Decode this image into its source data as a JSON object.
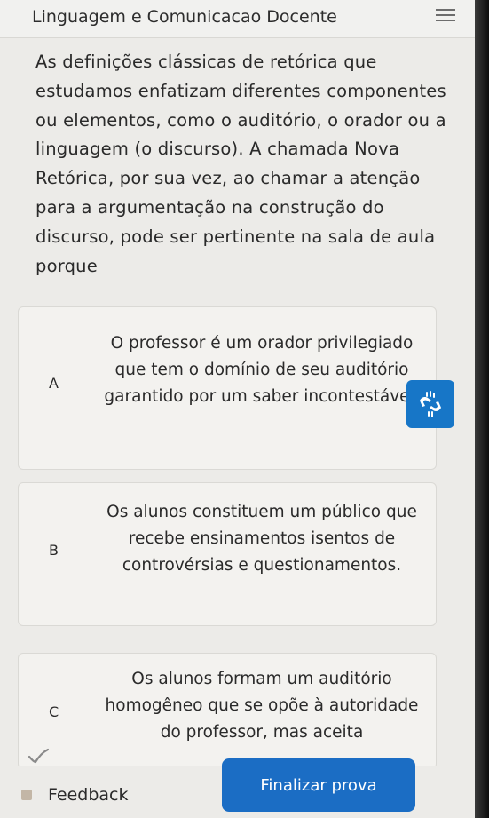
{
  "header": {
    "title": "Linguagem e Comunicacao Docente",
    "menu_icon": "hamburger-menu-icon"
  },
  "question": {
    "text": "As definições clássicas de retórica que estudamos enfatizam diferentes componentes ou elementos, como o auditório, o orador ou a linguagem (o discurso). A chamada Nova Retórica, por sua vez, ao chamar a atenção para a argumentação na construção do discurso, pode ser pertinente na sala de aula porque"
  },
  "options": [
    {
      "letter": "A",
      "text": "O professor é um orador privilegiado que tem o domínio de seu auditório garantido por um saber incontestável."
    },
    {
      "letter": "B",
      "text": "Os alunos constituem um público que recebe ensinamentos isentos de controvérsias e questionamentos."
    },
    {
      "letter": "C",
      "text": "Os alunos formam um auditório homogêneo que se opõe à autoridade do professor, mas aceita"
    }
  ],
  "accessibility_button": {
    "icon": "sign-language-hands-icon"
  },
  "footer": {
    "feedback_label": "Feedback",
    "finalize_label": "Finalizar prova"
  },
  "colors": {
    "accent": "#1b6dc4",
    "background": "#ecebe8",
    "text": "#2a2a2a"
  }
}
